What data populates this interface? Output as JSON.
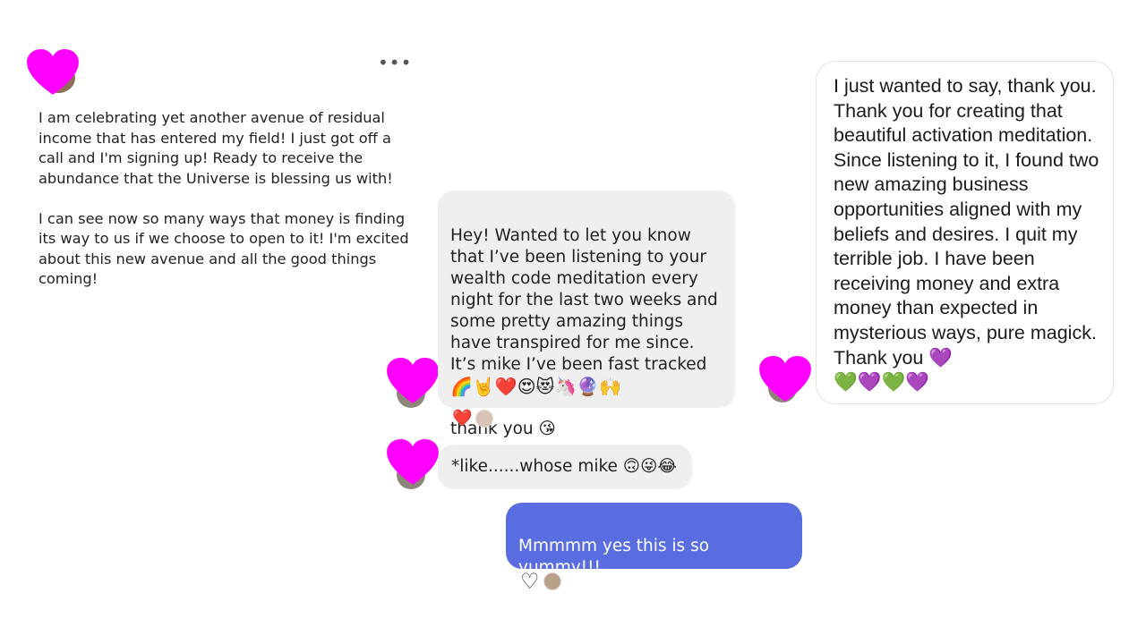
{
  "post": {
    "more_label": "•••",
    "text": "I am celebrating yet another avenue of residual income that has entered my field! I just got off a call and I'm signing up! Ready to receive the abundance that the Universe is blessing us with!\n\nI can see now so many ways that money is finding its way to us if we choose to open to it! I'm excited about this new avenue and all the good things coming!"
  },
  "chat": {
    "message1": "Hey! Wanted to let you know that I’ve been listening to your wealth code meditation every night for the last two weeks and some pretty amazing things have transpired for me since. It’s mike I’ve been fast tracked",
    "message1_emojis": "🌈🤘❤️😍😻🦄🔮🙌",
    "message1_sign": "thank you 😘",
    "message1_reaction": "❤️",
    "message2": "*like......whose mike 🙃😜😂",
    "message3": "Mmmmm yes this is so yummy!!!\nCelebrating you!!!",
    "message3_reaction": "♡"
  },
  "card": {
    "text": "I just wanted to say, thank you. Thank you for creating that beautiful activation meditation. Since listening to it, I found two new amazing business opportunities aligned with my beliefs and desires. I quit my terrible job. I have been receiving money and extra money than expected in mysterious ways, pure magick. Thank you 💜",
    "hearts": "💚💜💚💜"
  },
  "colors": {
    "overlay_heart": "#ff00ff",
    "sent_bubble": "#5a6de0",
    "received_bubble": "#efefef"
  },
  "icons": [
    "more-icon",
    "heart-overlay-icon",
    "heart-outline-icon"
  ]
}
